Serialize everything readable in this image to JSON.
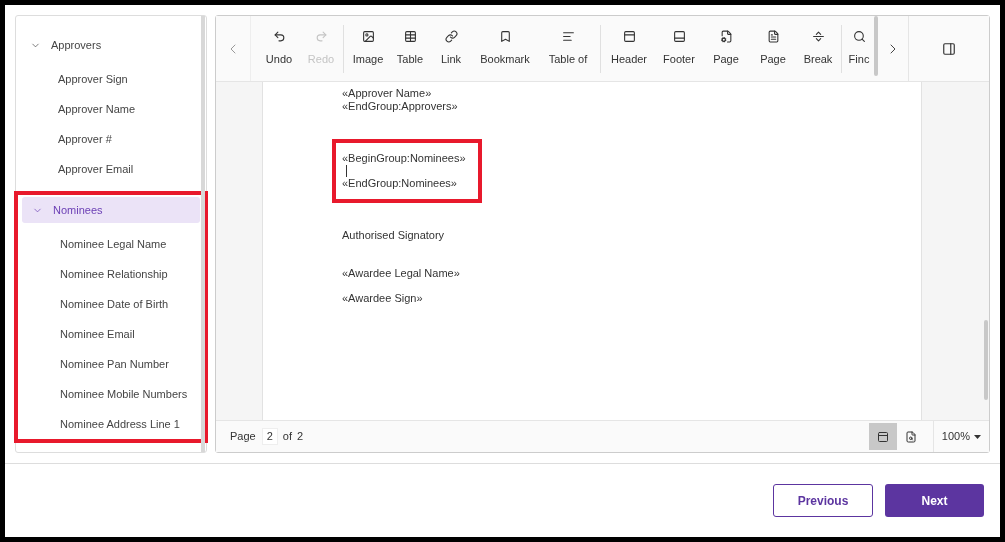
{
  "sidebar": {
    "groups": [
      {
        "label": "Approvers",
        "expanded": true,
        "selected": false,
        "highlighted": false,
        "children": [
          "Approver Sign",
          "Approver Name",
          "Approver #",
          "Approver Email"
        ]
      },
      {
        "label": "Nominees",
        "expanded": true,
        "selected": true,
        "highlighted": true,
        "children": [
          "Nominee Legal Name",
          "Nominee Relationship",
          "Nominee Date of Birth",
          "Nominee Email",
          "Nominee Pan Number",
          "Nominee Mobile Numbers",
          "Nominee Address Line 1"
        ]
      }
    ]
  },
  "toolbar": {
    "items": [
      {
        "kind": "button",
        "label": "Undo",
        "disabled": false
      },
      {
        "kind": "button",
        "label": "Redo",
        "disabled": true
      },
      {
        "kind": "separator"
      },
      {
        "kind": "button",
        "label": "Image",
        "disabled": false
      },
      {
        "kind": "button",
        "label": "Table",
        "disabled": false
      },
      {
        "kind": "button",
        "label": "Link",
        "disabled": false
      },
      {
        "kind": "button",
        "label": "Bookmark",
        "disabled": false
      },
      {
        "kind": "button",
        "label": "Table of",
        "disabled": false
      },
      {
        "kind": "separator"
      },
      {
        "kind": "button",
        "label": "Header",
        "disabled": false
      },
      {
        "kind": "button",
        "label": "Footer",
        "disabled": false
      },
      {
        "kind": "button",
        "label": "Page",
        "disabled": false
      },
      {
        "kind": "button",
        "label": "Page",
        "disabled": false
      },
      {
        "kind": "button",
        "label": "Break",
        "disabled": false
      },
      {
        "kind": "separator"
      },
      {
        "kind": "button",
        "label": "Finc",
        "disabled": false
      }
    ]
  },
  "document": {
    "lines": [
      {
        "text": "«Approver Name»",
        "highlighted": false,
        "cursor_after": false
      },
      {
        "text": "«EndGroup:Approvers»",
        "highlighted": false,
        "cursor_after": false
      },
      {
        "text": "«BeginGroup:Nominees»",
        "highlighted": true,
        "cursor_after": true
      },
      {
        "text": "«EndGroup:Nominees»",
        "highlighted": true,
        "cursor_after": false
      },
      {
        "text": "Authorised Signatory",
        "highlighted": false,
        "cursor_after": false
      },
      {
        "text": "«Awardee Legal Name»",
        "highlighted": false,
        "cursor_after": false
      },
      {
        "text": "«Awardee Sign»",
        "highlighted": false,
        "cursor_after": false
      }
    ]
  },
  "status_bar": {
    "page_label": "Page",
    "page_value": "2",
    "of_label": "of",
    "total_pages": "2",
    "zoom": "100%",
    "print_layout_selected": true,
    "web_layout_selected": false
  },
  "buttons": [
    {
      "label": "Previous",
      "kind": "secondary"
    },
    {
      "label": "Next",
      "kind": "primary"
    }
  ]
}
